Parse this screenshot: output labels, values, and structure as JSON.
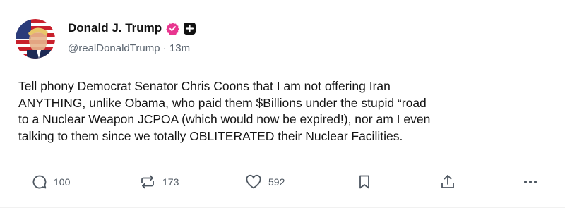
{
  "colors": {
    "verified_badge": "#e8368f",
    "text": "#141414",
    "secondary_text": "#5b6570",
    "icon": "#4d5660"
  },
  "author": {
    "display_name": "Donald J. Trump",
    "handle": "@realDonaldTrump",
    "separator": "·",
    "time_ago": "13m",
    "verified_icon": "verified-check-icon",
    "follow_icon": "plus-icon"
  },
  "post": {
    "lines": [
      "Tell phony Democrat Senator Chris Coons that I am not offering Iran",
      "ANYTHING, unlike Obama, who paid them $Billions under the stupid “road",
      "to a Nuclear Weapon JCPOA (which would now be expired!), nor am I even",
      "talking to them since we totally OBLITERATED their Nuclear Facilities."
    ]
  },
  "actions": {
    "reply": {
      "icon": "reply-icon",
      "count": "100"
    },
    "repost": {
      "icon": "repost-icon",
      "count": "173"
    },
    "like": {
      "icon": "heart-icon",
      "count": "592"
    },
    "bookmark": {
      "icon": "bookmark-icon"
    },
    "share": {
      "icon": "share-icon"
    },
    "more": {
      "icon": "more-icon"
    }
  }
}
